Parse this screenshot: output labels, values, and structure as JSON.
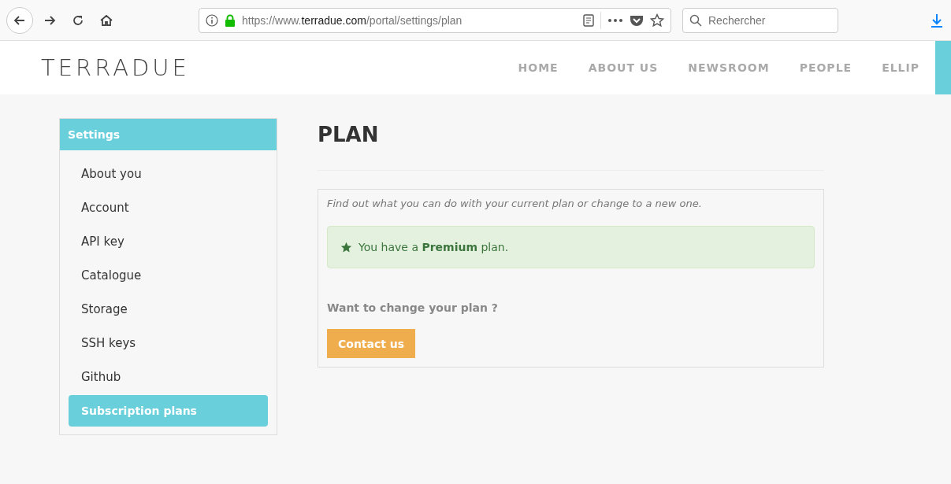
{
  "browser": {
    "url_prefix": "https://www.",
    "url_domain": "terradue.com",
    "url_path": "/portal/settings/plan",
    "search": {
      "placeholder": "Rechercher"
    }
  },
  "site": {
    "logo": "TERRADUE",
    "nav": [
      {
        "label": "HOME"
      },
      {
        "label": "ABOUT US"
      },
      {
        "label": "NEWSROOM"
      },
      {
        "label": "PEOPLE"
      },
      {
        "label": "ELLIP"
      }
    ]
  },
  "sidebar": {
    "title": "Settings",
    "items": [
      {
        "label": "About you",
        "selected": false
      },
      {
        "label": "Account",
        "selected": false
      },
      {
        "label": "API key",
        "selected": false
      },
      {
        "label": "Catalogue",
        "selected": false
      },
      {
        "label": "Storage",
        "selected": false
      },
      {
        "label": "SSH keys",
        "selected": false
      },
      {
        "label": "Github",
        "selected": false
      },
      {
        "label": "Subscription plans",
        "selected": true
      }
    ]
  },
  "main": {
    "title": "PLAN",
    "intro": "Find out what you can do with your current plan or change to a new one.",
    "alert": "You have a **Premium** plan.",
    "question": "Want to change your plan ?",
    "button": "Contact us"
  }
}
